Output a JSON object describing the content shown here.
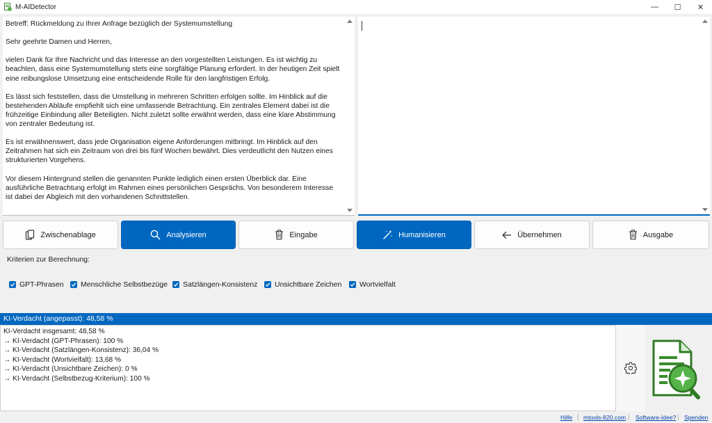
{
  "window": {
    "title": "M-AIDetector",
    "controls": [
      "—",
      "☐",
      "✕"
    ]
  },
  "left_editor": {
    "paragraphs": [
      "Betreff: Rückmeldung zu Ihrer Anfrage bezüglich der Systemumstellung",
      "Sehr geehrte Damen und Herren,",
      "vielen Dank für Ihre Nachricht und das Interesse an den vorgestellten Leistungen. Es ist wichtig zu beachten, dass eine Systemumstellung stets eine sorgfältige Planung erfordert. In der heutigen Zeit spielt eine reibungslose Umsetzung eine entscheidende Rolle für den langfristigen Erfolg.",
      "Es lässt sich feststellen, dass die Umstellung in mehreren Schritten erfolgen sollte. Im Hinblick auf die bestehenden Abläufe empfiehlt sich eine umfassende Betrachtung. Ein zentrales Element dabei ist die frühzeitige Einbindung aller Beteiligten. Nicht zuletzt sollte erwähnt werden, dass eine klare Abstimmung von zentraler Bedeutung ist.",
      "Es ist erwähnenswert, dass jede Organisation eigene Anforderungen mitbringt. Im Hinblick auf den Zeitrahmen hat sich ein Zeitraum von drei bis fünf Wochen bewährt. Dies verdeutlicht den Nutzen eines strukturierten Vorgehens.",
      "Vor diesem Hintergrund stellen die genannten Punkte lediglich einen ersten Überblick dar. Eine ausführliche Betrachtung erfolgt im Rahmen eines persönlichen Gesprächs. Von besonderem Interesse ist dabei der Abgleich mit den vorhandenen Schnittstellen."
    ]
  },
  "right_editor": {
    "text": ""
  },
  "buttons": {
    "clipboard": "Zwischenablage",
    "analyze": "Analysieren",
    "clear_input": "Eingabe",
    "humanize": "Humanisieren",
    "apply": "Übernehmen",
    "clear_output": "Ausgabe"
  },
  "criteria": {
    "label": "Kriterien zur Berechnung:",
    "items": [
      {
        "label": "GPT-Phrasen",
        "checked": true
      },
      {
        "label": "Menschliche Selbstbezüge",
        "checked": true
      },
      {
        "label": "Satzlängen-Konsistenz",
        "checked": true
      },
      {
        "label": "Unsichtbare Zeichen",
        "checked": true
      },
      {
        "label": "Wortvielfalt",
        "checked": true
      }
    ]
  },
  "result": {
    "header": "KI-Verdacht (angepasst): 48,58 %",
    "lines": [
      "KI-Verdacht insgesamt: 48,58 %",
      "→ KI-Verdacht (GPT-Phrasen): 100 %",
      "→ KI-Verdacht (Satzlängen-Konsistenz): 36,04 %",
      "→ KI-Verdacht (Wortvielfalt): 13,68 %",
      "→ KI-Verdacht (Unsichtbare Zeichen): 0 %",
      "→ KI-Verdacht (Selbstbezug-Kriterium): 100 %"
    ]
  },
  "footer": {
    "links": [
      "Hilfe",
      "mtools-820.com",
      "Software-Idee?",
      "Spenden"
    ],
    "separator": "|"
  },
  "colors": {
    "accent": "#0067c0",
    "logo_green": "#3a8a2e",
    "background": "#f0f0f0"
  }
}
